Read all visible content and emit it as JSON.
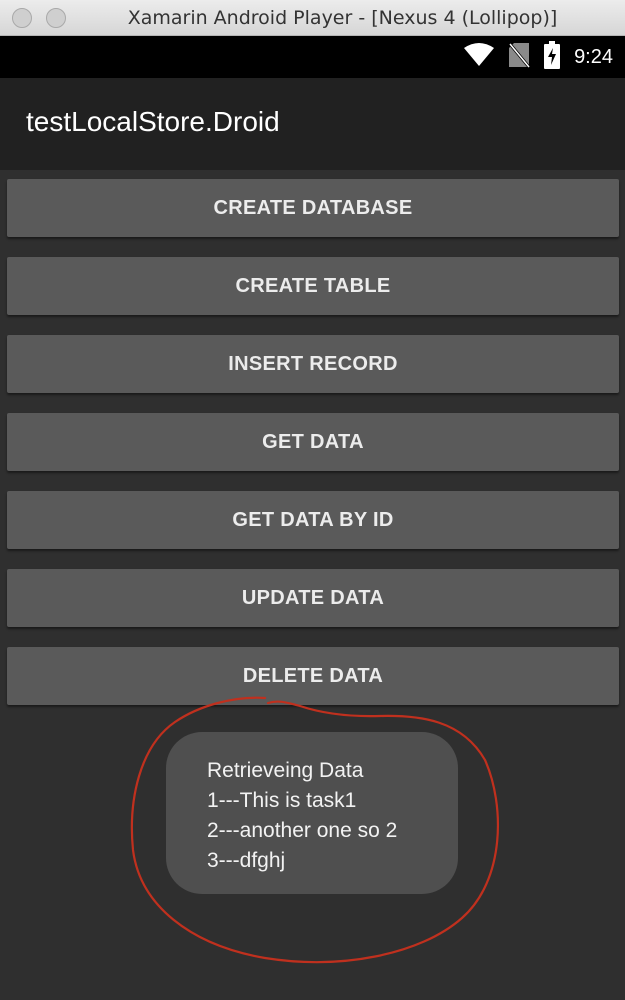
{
  "window": {
    "title": "Xamarin Android Player - [Nexus 4 (Lollipop)]"
  },
  "status_bar": {
    "time": "9:24",
    "icons": [
      "wifi-icon",
      "no-sim-icon",
      "battery-charging-icon"
    ]
  },
  "app": {
    "title": "testLocalStore.Droid"
  },
  "buttons": [
    {
      "label": "CREATE DATABASE"
    },
    {
      "label": "CREATE TABLE"
    },
    {
      "label": "INSERT RECORD"
    },
    {
      "label": "GET DATA"
    },
    {
      "label": "GET DATA BY ID"
    },
    {
      "label": "UPDATE DATA"
    },
    {
      "label": "DELETE DATA"
    }
  ],
  "toast": {
    "lines": [
      "Retrieveing Data",
      "1---This is task1",
      "2---another one so 2",
      "3---dfghj"
    ]
  },
  "colors": {
    "annotation": "#c0301e",
    "button_bg": "#5a5a5a",
    "background": "#2f2f2f"
  }
}
